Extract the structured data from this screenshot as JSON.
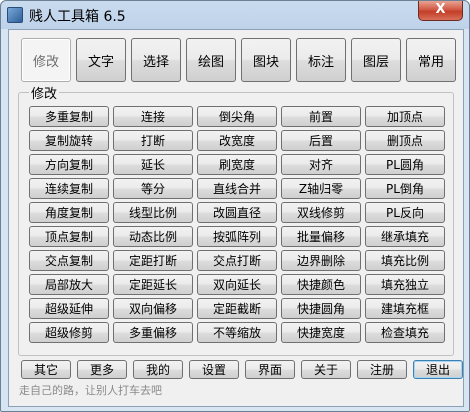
{
  "window": {
    "title": "贱人工具箱 6.5",
    "close_label": "X"
  },
  "tabs": [
    {
      "label": "修改",
      "active": true
    },
    {
      "label": "文字",
      "active": false
    },
    {
      "label": "选择",
      "active": false
    },
    {
      "label": "绘图",
      "active": false
    },
    {
      "label": "图块",
      "active": false
    },
    {
      "label": "标注",
      "active": false
    },
    {
      "label": "图层",
      "active": false
    },
    {
      "label": "常用",
      "active": false
    }
  ],
  "group": {
    "label": "修改",
    "buttons": [
      "多重复制",
      "连接",
      "倒尖角",
      "前置",
      "加顶点",
      "复制旋转",
      "打断",
      "改宽度",
      "后置",
      "删顶点",
      "方向复制",
      "延长",
      "刷宽度",
      "对齐",
      "PL圆角",
      "连续复制",
      "等分",
      "直线合并",
      "Z轴归零",
      "PL倒角",
      "角度复制",
      "线型比例",
      "改圆直径",
      "双线修剪",
      "PL反向",
      "顶点复制",
      "动态比例",
      "按弧阵列",
      "批量偏移",
      "继承填充",
      "交点复制",
      "定距打断",
      "交点打断",
      "边界删除",
      "填充比例",
      "局部放大",
      "定距延长",
      "双向延长",
      "快捷颜色",
      "填充独立",
      "超级延伸",
      "双向偏移",
      "定距截断",
      "快捷圆角",
      "建填充框",
      "超级修剪",
      "多重偏移",
      "不等缩放",
      "快捷宽度",
      "检查填充"
    ]
  },
  "bottom_buttons": [
    {
      "label": "其它",
      "default": false
    },
    {
      "label": "更多",
      "default": false
    },
    {
      "label": "我的",
      "default": false
    },
    {
      "label": "设置",
      "default": false
    },
    {
      "label": "界面",
      "default": false
    },
    {
      "label": "关于",
      "default": false
    },
    {
      "label": "注册",
      "default": false
    },
    {
      "label": "退出",
      "default": true
    }
  ],
  "status_text": "走自己的路，让别人打车去吧"
}
